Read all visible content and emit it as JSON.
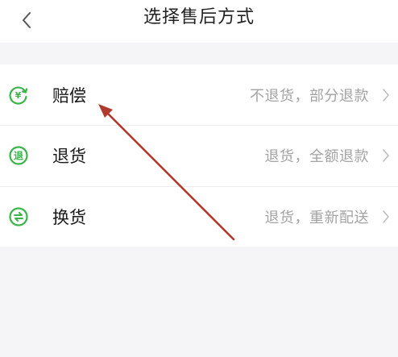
{
  "header": {
    "title": "选择售后方式",
    "back_icon": "chevron-left-icon"
  },
  "options": [
    {
      "label": "赔偿",
      "description": "不退货，部分退款",
      "icon": "refresh-yen-icon"
    },
    {
      "label": "退货",
      "description": "退货，全额退款",
      "icon": "return-icon"
    },
    {
      "label": "换货",
      "description": "退货，重新配送",
      "icon": "exchange-icon"
    }
  ],
  "colors": {
    "accent_green": "#3bb54a",
    "annotation_arrow": "#b03a2e",
    "background": "#f5f5f7",
    "chevron": "#bdbdbd"
  }
}
